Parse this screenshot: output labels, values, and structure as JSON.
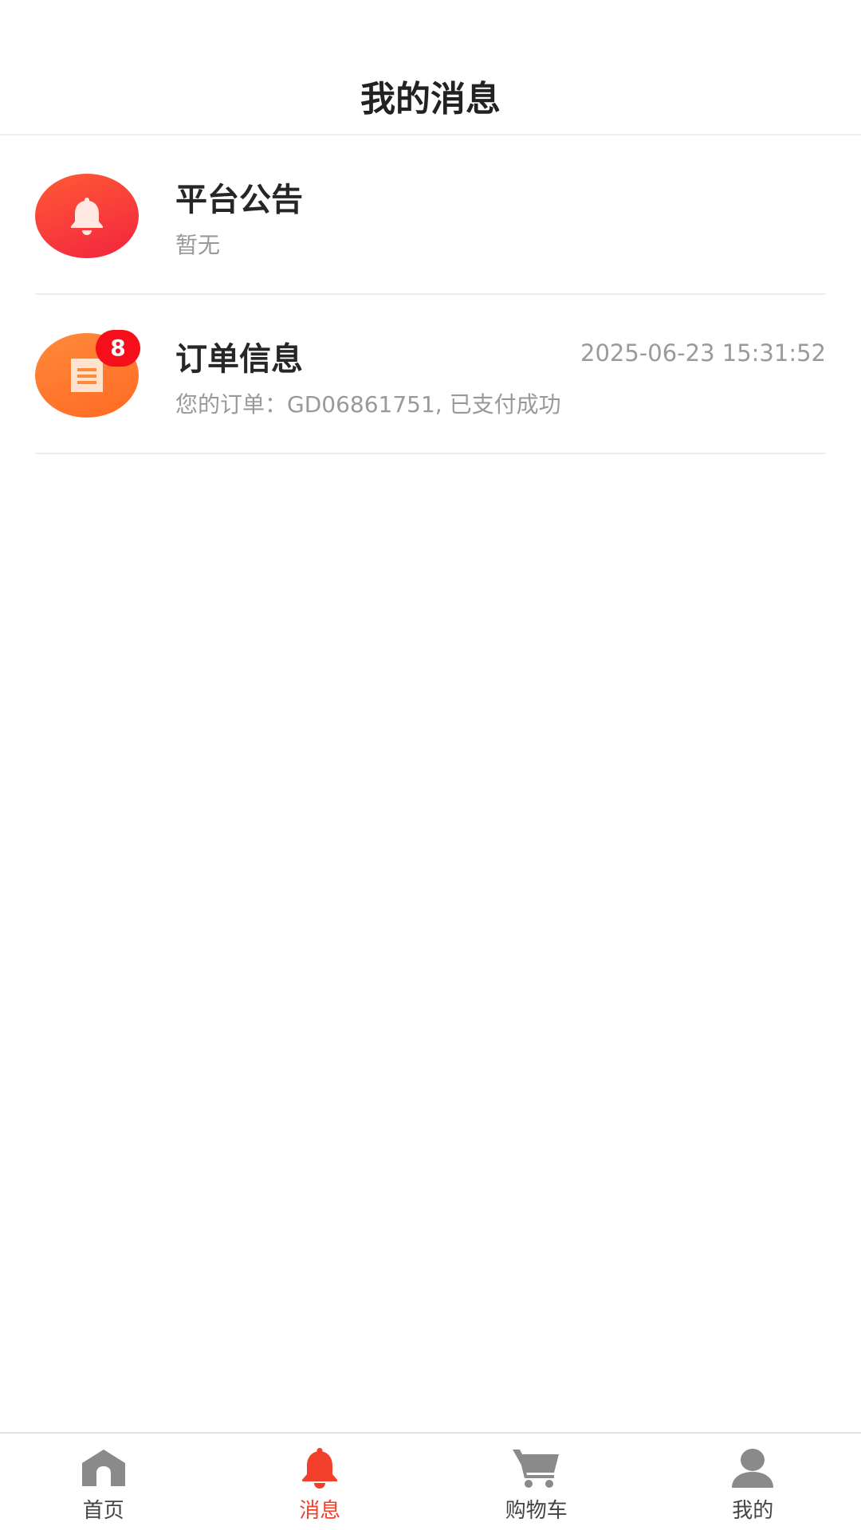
{
  "header": {
    "title": "我的消息"
  },
  "messages": [
    {
      "title": "平台公告",
      "content": "暂无",
      "time": "",
      "badge": "",
      "icon": "bell-icon",
      "icon_color": "#f5333a"
    },
    {
      "title": "订单信息",
      "content": "您的订单：GD06861751, 已支付成功",
      "time": "2025-06-23 15:31:52",
      "badge": "8",
      "icon": "document-icon",
      "icon_color": "#ff7a2d"
    }
  ],
  "tabbar": {
    "active_color": "#f2402c",
    "inactive_color": "#888888",
    "items": [
      {
        "label": "首页",
        "icon": "home-icon",
        "active": false
      },
      {
        "label": "消息",
        "icon": "bell-icon",
        "active": true
      },
      {
        "label": "购物车",
        "icon": "cart-icon",
        "active": false
      },
      {
        "label": "我的",
        "icon": "user-icon",
        "active": false
      }
    ]
  }
}
